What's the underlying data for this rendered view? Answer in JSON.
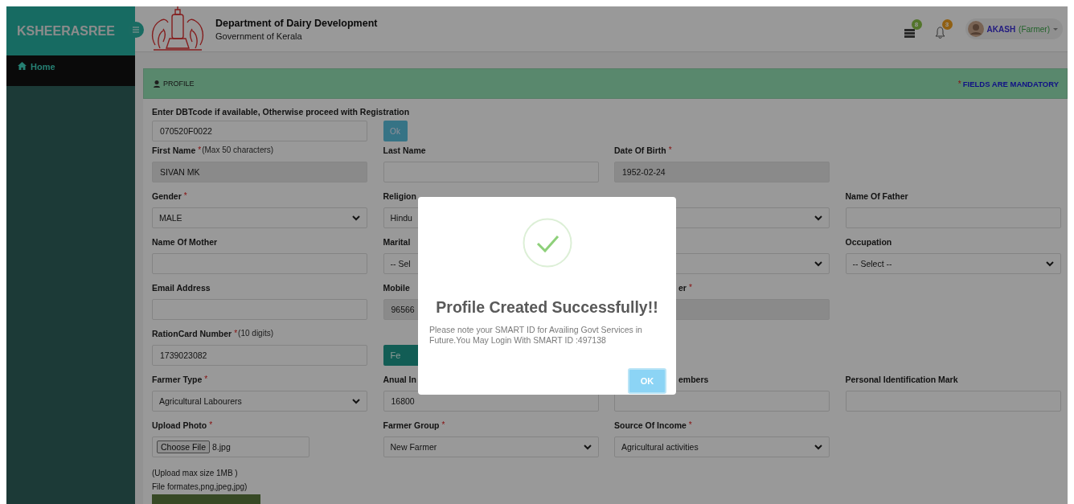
{
  "sidebar": {
    "brand": "KSHEERASREE",
    "items": [
      {
        "label": "Home",
        "selected": true
      }
    ]
  },
  "header": {
    "title": "Department of Dairy Development",
    "subtitle": "Government of Kerala",
    "notifications": [
      {
        "kind": "messages",
        "count": "8",
        "color": "#53752c"
      },
      {
        "kind": "alerts",
        "count": "3",
        "color": "#906013"
      }
    ],
    "user": {
      "name": "AKASH",
      "role": "(Farmer)"
    }
  },
  "panel": {
    "title": "PROFILE",
    "mandatory_mark": "*",
    "mandatory_note": "FIELDS ARE MANDATORY"
  },
  "form": {
    "dbt": {
      "label": "Enter DBTcode if available, Otherwise proceed with Registration",
      "value": "070520F0022",
      "button": "Ok"
    },
    "rows": [
      [
        {
          "label": "First Name",
          "required_mark": "*",
          "hint": "(Max 50 characters)",
          "kind": "text",
          "value": "SIVAN MK",
          "disabled": true
        },
        {
          "label": "Last Name",
          "kind": "text",
          "disabled": false
        },
        {
          "label": "Date Of Birth",
          "required_mark": "*",
          "kind": "text",
          "value": "1952-02-24",
          "disabled": true
        },
        {
          "kind": "empty"
        }
      ],
      [
        {
          "label": "Gender",
          "required_mark": "*",
          "kind": "select",
          "value": "MALE"
        },
        {
          "label": "Religion",
          "kind": "select",
          "value": "Hindu"
        },
        {
          "kind": "select"
        },
        {
          "label": "Name Of Father",
          "kind": "text",
          "disabled": false
        }
      ],
      [
        {
          "label": "Name Of Mother",
          "kind": "text",
          "disabled": false
        },
        {
          "label": "Marital",
          "kind": "select",
          "value": "-- Sel"
        },
        {
          "kind": "select"
        },
        {
          "label": "Occupation",
          "kind": "select",
          "value": "-- Select --"
        }
      ],
      [
        {
          "label": "Email Address",
          "kind": "text",
          "disabled": false
        },
        {
          "label": "Mobile",
          "kind": "text",
          "value": "96566",
          "disabled": true
        },
        {
          "label": "er",
          "required_mark": "*",
          "kind": "text",
          "disabled": true
        },
        {
          "kind": "empty"
        }
      ],
      [
        {
          "label": "RationCard Number",
          "required_mark": "*",
          "hint": "(10 digits)",
          "kind": "text",
          "value": "1739023082",
          "disabled": false
        },
        {
          "kind": "button",
          "value": "Fe"
        },
        {
          "kind": "empty"
        },
        {
          "kind": "empty"
        }
      ],
      [
        {
          "label": "Farmer Type",
          "required_mark": "*",
          "kind": "select",
          "value": "Agricultural Labourers"
        },
        {
          "label": "Anual In",
          "kind": "text",
          "value": "16800",
          "disabled": false
        },
        {
          "label": "embers",
          "kind": "text",
          "disabled": false
        },
        {
          "label": "Personal Identification Mark",
          "kind": "text",
          "disabled": false
        }
      ],
      [
        {
          "label": "Upload Photo",
          "required_mark": "*",
          "kind": "file",
          "button": "Choose File",
          "value": "8.jpg"
        },
        {
          "label": "Farmer Group",
          "required_mark": "*",
          "kind": "select",
          "value": "New Farmer"
        },
        {
          "label": "Source Of Income",
          "required_mark": "*",
          "kind": "select",
          "value": "Agricultural activities"
        },
        {
          "kind": "empty"
        }
      ]
    ],
    "upload_notes": [
      "(Upload max size 1MB )",
      "File formates,png,jpeg,jpg)"
    ]
  },
  "dialog": {
    "title": "Profile Created Successfully!!",
    "message": "Please note your SMART ID for Availing Govt Services in Future.You May Login With SMART ID :497138",
    "button": "OK"
  }
}
